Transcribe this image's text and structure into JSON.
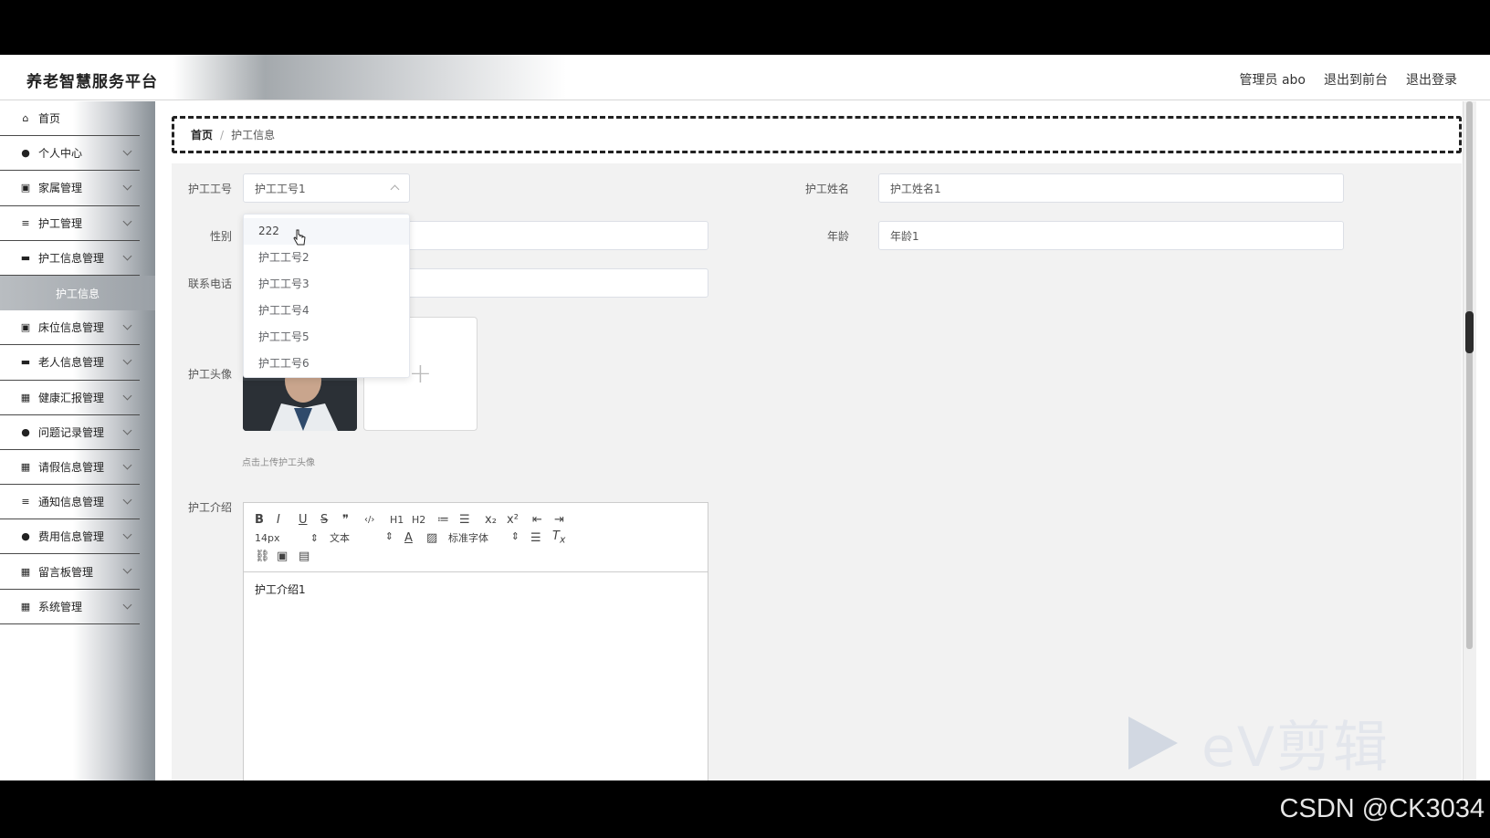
{
  "header": {
    "brand": "养老智慧服务平台",
    "admin": "管理员 abo",
    "to_front": "退出到前台",
    "logout": "退出登录"
  },
  "sidebar": {
    "items": [
      {
        "label": "首页",
        "icon": "home-icon"
      },
      {
        "label": "个人中心",
        "icon": "user-icon"
      },
      {
        "label": "家属管理",
        "icon": "clipboard-icon"
      },
      {
        "label": "护工管理",
        "icon": "list-icon"
      },
      {
        "label": "护工信息管理",
        "icon": "monitor-icon"
      },
      {
        "label": "护工信息",
        "icon": ""
      },
      {
        "label": "床位信息管理",
        "icon": "clipboard-icon"
      },
      {
        "label": "老人信息管理",
        "icon": "monitor-icon"
      },
      {
        "label": "健康汇报管理",
        "icon": "grid-icon"
      },
      {
        "label": "问题记录管理",
        "icon": "user-icon"
      },
      {
        "label": "请假信息管理",
        "icon": "grid-icon"
      },
      {
        "label": "通知信息管理",
        "icon": "list-icon"
      },
      {
        "label": "费用信息管理",
        "icon": "user-icon"
      },
      {
        "label": "留言板管理",
        "icon": "grid-icon"
      },
      {
        "label": "系统管理",
        "icon": "grid-icon"
      }
    ]
  },
  "breadcrumb": {
    "home": "首页",
    "sep": "/",
    "current": "护工信息"
  },
  "form": {
    "worker_id_label": "护工工号",
    "worker_id_value": "护工工号1",
    "worker_name_label": "护工姓名",
    "worker_name_value": "护工姓名1",
    "gender_label": "性别",
    "age_label": "年龄",
    "age_value": "年龄1",
    "phone_label": "联系电话",
    "avatar_label": "护工头像",
    "avatar_hint": "点击上传护工头像",
    "intro_label": "护工介绍",
    "intro_value": "护工介绍1"
  },
  "dropdown": {
    "options": [
      "222",
      "护工工号2",
      "护工工号3",
      "护工工号4",
      "护工工号5",
      "护工工号6"
    ]
  },
  "editor": {
    "font_size": "14px",
    "block_format": "文本",
    "font_family": "标准字体",
    "row1": [
      "B",
      "I",
      "U",
      "S",
      "❞",
      "‹/›",
      "H1",
      "H2",
      "≔",
      "☰",
      "x₂",
      "x²",
      "⇤",
      "⇥"
    ]
  },
  "watermark": {
    "text": "eV剪辑"
  },
  "csdn": "CSDN @CK3034"
}
